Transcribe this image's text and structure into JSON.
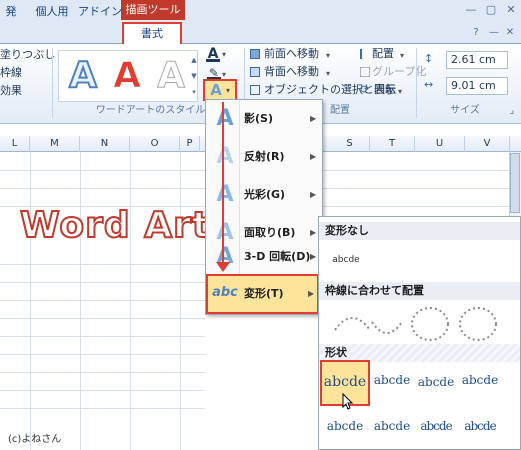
{
  "window": {
    "tool_group": "描画ツール",
    "controls": [
      "—",
      "▢",
      "✕"
    ]
  },
  "tabs": [
    "発",
    "個人用",
    "アドイン",
    "書式"
  ],
  "ribbon": {
    "shape_styles": [
      "塗りつぶし",
      "枠線",
      "効果"
    ],
    "wordart_group_label": "ワードアートのスタイル",
    "arrange_items": [
      "前面へ移動",
      "背面へ移動",
      "オブジェクトの選択と表示"
    ],
    "arrange_right": [
      "配置",
      "グループ化",
      "回転"
    ],
    "arrange_group_label": "配置",
    "size_group_label": "サイズ",
    "height_value": "2.61 cm",
    "width_value": "9.01 cm",
    "wordart_samples": [
      "A",
      "A",
      "A"
    ]
  },
  "sheet": {
    "columns": [
      "L",
      "M",
      "N",
      "O",
      "P",
      "S",
      "T",
      "U",
      "V"
    ],
    "wordart_text": "Word Art",
    "credit": "(c)よねさん"
  },
  "effects_menu": {
    "items": [
      {
        "label": "影(S)",
        "icon": "A"
      },
      {
        "label": "反射(R)",
        "icon": "A"
      },
      {
        "label": "光彩(G)",
        "icon": "A"
      },
      {
        "label": "面取り(B)",
        "icon": "A"
      },
      {
        "label": "3-D 回転(D)",
        "icon": "A"
      },
      {
        "label": "変形(T)",
        "icon": "abc"
      }
    ]
  },
  "transform_gallery": {
    "no_transform_header": "変形なし",
    "no_transform_item": "abcde",
    "follow_path_header": "枠線に合わせて配置",
    "warp_header": "形状",
    "warp_items": [
      "abcde",
      "abcde",
      "abcde",
      "abcde",
      "abcde",
      "abcde",
      "abcde",
      "abcde"
    ]
  }
}
